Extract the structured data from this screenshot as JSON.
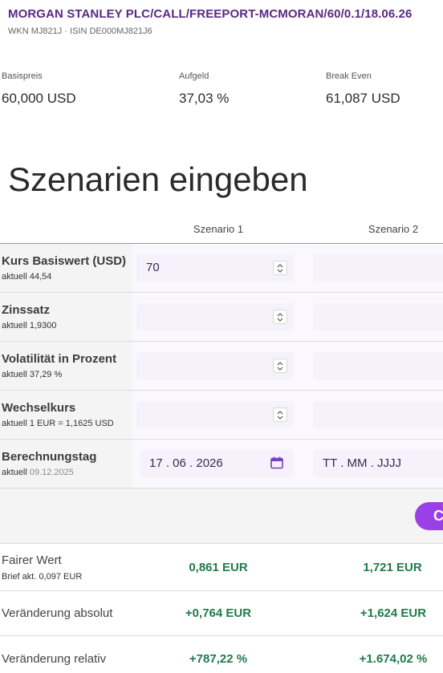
{
  "product": {
    "title": "MORGAN STANLEY PLC/CALL/FREEPORT-MCMORAN/60/0.1/18.06.26",
    "identifiers": "WKN MJ821J · ISIN DE000MJ821J6"
  },
  "metrics": [
    {
      "label": "Basispreis",
      "value": "60,000 USD"
    },
    {
      "label": "Aufgeld",
      "value": "37,03 %"
    },
    {
      "label": "Break Even",
      "value": "61,087 USD"
    }
  ],
  "scenarios": {
    "heading": "Szenarien eingeben",
    "columns": [
      "Szenario 1",
      "Szenario 2"
    ]
  },
  "inputs": [
    {
      "label": "Kurs Basiswert (USD)",
      "sub_prefix": "aktuell",
      "sub_value": "44,54",
      "s1_value": "70",
      "s2_value": ""
    },
    {
      "label": "Zinssatz",
      "sub_prefix": "aktuell",
      "sub_value": "1,9300",
      "s1_value": "",
      "s2_value": ""
    },
    {
      "label": "Volatilität in Prozent",
      "sub_prefix": "aktuell",
      "sub_value": "37,29 %",
      "s1_value": "",
      "s2_value": ""
    },
    {
      "label": "Wechselkurs",
      "sub_prefix": "aktuell",
      "sub_value": "1 EUR = 1,1625 USD",
      "s1_value": "",
      "s2_value": ""
    },
    {
      "label": "Berechnungstag",
      "sub_prefix": "aktuell",
      "sub_value": "09.12.2025",
      "s1_value": "17 . 06 . 2026",
      "s2_value": "TT . MM . JJJJ"
    }
  ],
  "button": {
    "label": "C"
  },
  "results": [
    {
      "label": "Fairer Wert",
      "sub": "Brief akt. 0,097 EUR",
      "s1": "0,861 EUR",
      "s2": "1,721 EUR"
    },
    {
      "label": "Veränderung absolut",
      "sub": "",
      "s1": "+0,764 EUR",
      "s2": "+1,624 EUR"
    },
    {
      "label": "Veränderung relativ",
      "sub": "",
      "s1": "+787,22 %",
      "s2": "+1.674,02 %"
    }
  ],
  "colors": {
    "accent": "#9b3fe6",
    "title": "#5a2a82",
    "positive": "#1f7a4d"
  }
}
